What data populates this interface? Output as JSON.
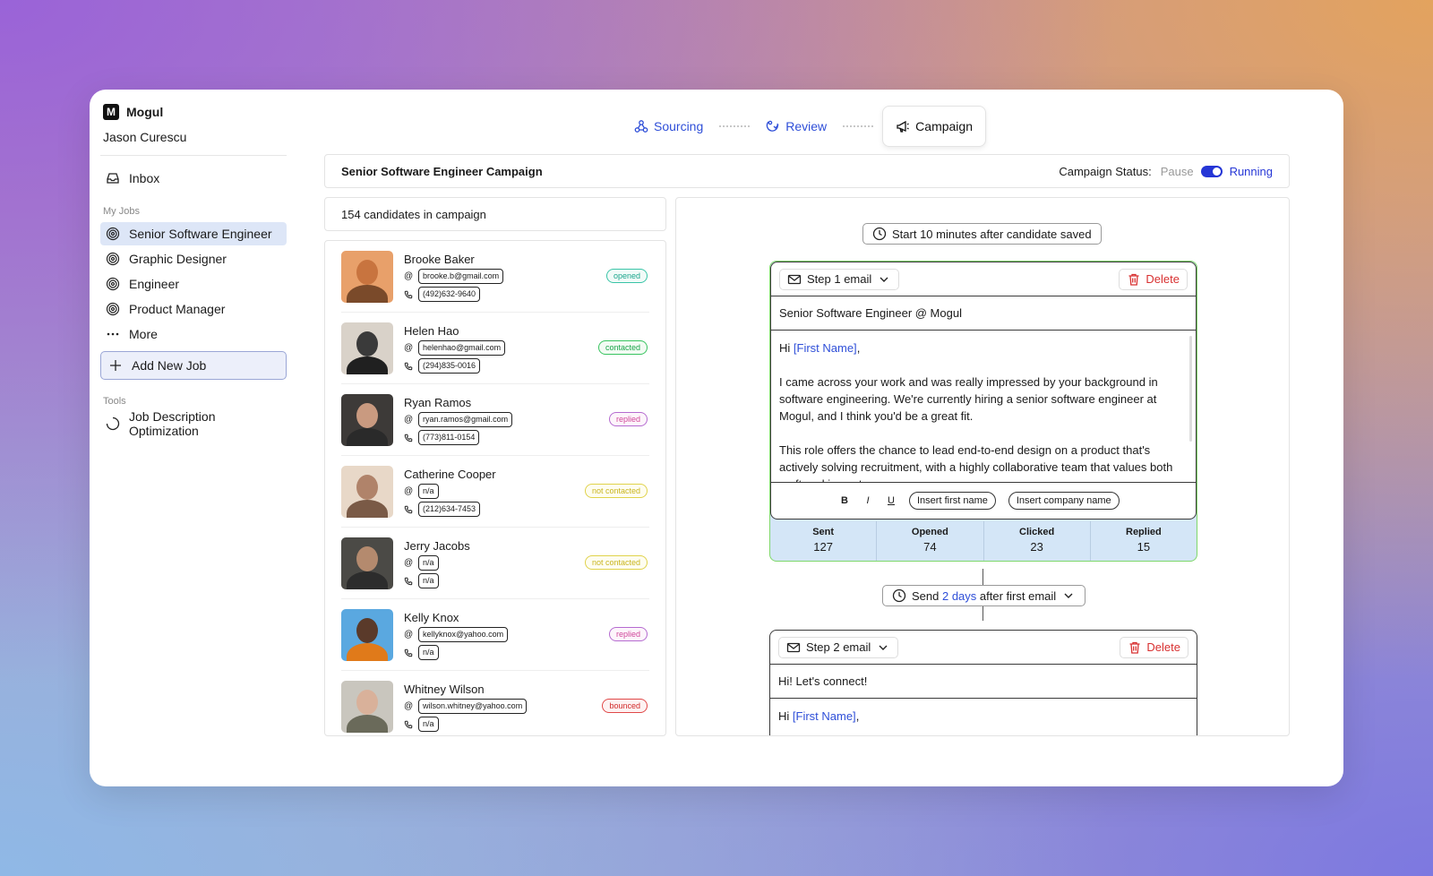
{
  "sidebar": {
    "brand": "Mogul",
    "brand_initial": "M",
    "user": "Jason Curescu",
    "inbox": "Inbox",
    "my_jobs_label": "My Jobs",
    "jobs": [
      "Senior Software Engineer",
      "Graphic Designer",
      "Engineer",
      "Product Manager"
    ],
    "more": "More",
    "add_job": "Add New Job",
    "tools_label": "Tools",
    "tools": [
      "Job Description Optimization"
    ]
  },
  "stepper": {
    "sourcing": "Sourcing",
    "review": "Review",
    "campaign": "Campaign"
  },
  "campaign": {
    "title": "Senior Software Engineer Campaign",
    "status_label": "Campaign Status:",
    "pause": "Pause",
    "running": "Running",
    "candidate_count": "154 candidates in campaign"
  },
  "candidates": [
    {
      "name": "Brooke Baker",
      "email": "brooke.b@gmail.com",
      "phone": "(492)632-9640",
      "status": "opened"
    },
    {
      "name": "Helen Hao",
      "email": "helenhao@gmail.com",
      "phone": "(294)835-0016",
      "status": "contacted"
    },
    {
      "name": "Ryan Ramos",
      "email": "ryan.ramos@gmail.com",
      "phone": "(773)811-0154",
      "status": "replied"
    },
    {
      "name": "Catherine Cooper",
      "email": "n/a",
      "phone": "(212)634-7453",
      "status": "not contacted"
    },
    {
      "name": "Jerry Jacobs",
      "email": "n/a",
      "phone": "n/a",
      "status": "not contacted"
    },
    {
      "name": "Kelly Knox",
      "email": "kellyknox@yahoo.com",
      "phone": "n/a",
      "status": "replied"
    },
    {
      "name": "Whitney Wilson",
      "email": "wilson.whitney@yahoo.com",
      "phone": "n/a",
      "status": "bounced"
    }
  ],
  "sequence": {
    "start": "Start 10 minutes after candidate saved",
    "step1": {
      "label": "Step 1 email",
      "delete": "Delete",
      "subject": "Senior Software Engineer @ Mogul",
      "greeting": "Hi ",
      "first_name_var": "[First Name]",
      "greeting_end": ",",
      "p1": "I came across your work and was really impressed by your background in software engineering. We're currently hiring a senior software engineer at Mogul, and I think you'd be a great fit.",
      "p2": "This role offers the chance to lead end-to-end design on a product that's actively solving recruitment, with a highly collaborative team that values both craft and impact.",
      "bold": "B",
      "italic": "I",
      "underline": "U",
      "insert_first": "Insert first name",
      "insert_company": "Insert company name"
    },
    "stats": [
      {
        "label": "Sent",
        "value": "127"
      },
      {
        "label": "Opened",
        "value": "74"
      },
      {
        "label": "Clicked",
        "value": "23"
      },
      {
        "label": "Replied",
        "value": "15"
      }
    ],
    "delay": {
      "prefix": "Send ",
      "days": "2 days",
      "suffix": " after first email"
    },
    "step2": {
      "label": "Step 2 email",
      "delete": "Delete",
      "subject": "Hi! Let's connect!",
      "greeting": "Hi ",
      "first_name_var": "[First Name]",
      "greeting_end": ","
    }
  },
  "colors": {
    "accent": "#2536d6",
    "link": "#2f4fd8",
    "delete": "#d83030",
    "step1_border": "#7fd86a",
    "stats_bg": "#d4e6f7"
  }
}
